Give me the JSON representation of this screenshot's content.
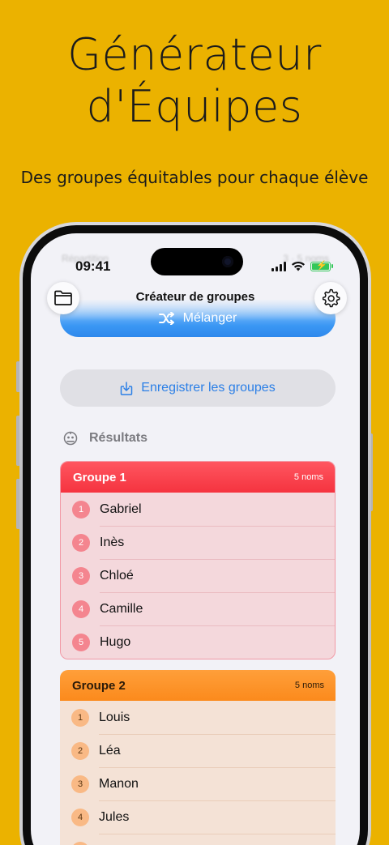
{
  "hero": {
    "title_line1": "Générateur",
    "title_line2": "d'Équipes",
    "subtitle": "Des groupes équitables pour chaque élève"
  },
  "status_bar": {
    "time": "09:41",
    "ghost_left": "Répartition",
    "ghost_right": "3 · 5 noms"
  },
  "nav": {
    "title": "Créateur de groupes",
    "left_icon": "folder-icon",
    "right_icon": "gear-icon"
  },
  "actions": {
    "shuffle_label": "Mélanger",
    "save_label": "Enregistrer les groupes"
  },
  "results": {
    "header": "Résultats"
  },
  "groups": [
    {
      "name": "Groupe 1",
      "count": "5 noms",
      "color": "#F5333F",
      "members": [
        {
          "n": "1",
          "name": "Gabriel"
        },
        {
          "n": "2",
          "name": "Inès"
        },
        {
          "n": "3",
          "name": "Chloé"
        },
        {
          "n": "4",
          "name": "Camille"
        },
        {
          "n": "5",
          "name": "Hugo"
        }
      ]
    },
    {
      "name": "Groupe 2",
      "count": "5 noms",
      "color": "#FB8A1C",
      "members": [
        {
          "n": "1",
          "name": "Louis"
        },
        {
          "n": "2",
          "name": "Léa"
        },
        {
          "n": "3",
          "name": "Manon"
        },
        {
          "n": "4",
          "name": "Jules"
        }
      ]
    }
  ],
  "colors": {
    "background": "#EBB200",
    "accent_blue": "#2B7FE6"
  }
}
